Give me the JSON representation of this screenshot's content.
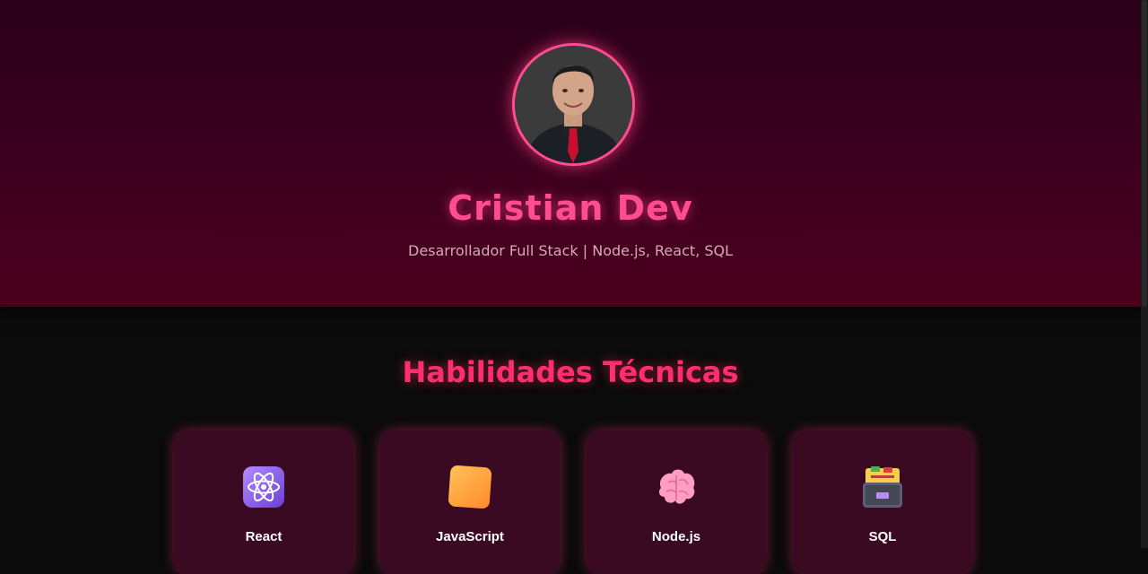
{
  "profile": {
    "name": "Cristian Dev",
    "subtitle": "Desarrollador Full Stack | Node.js, React, SQL",
    "avatar_alt": "profile-photo"
  },
  "skills": {
    "title": "Habilidades Técnicas",
    "items": [
      {
        "label": "React",
        "icon": "atom-icon"
      },
      {
        "label": "JavaScript",
        "icon": "orange-square-icon"
      },
      {
        "label": "Node.js",
        "icon": "brain-icon"
      },
      {
        "label": "SQL",
        "icon": "file-cabinet-icon"
      }
    ]
  },
  "colors": {
    "accent": "#ff4d8f",
    "title": "#ff2e6e",
    "card_bg": "#3a0a22",
    "hero_top": "#2a0019",
    "hero_bottom": "#4a001d",
    "page_bg": "#0b0b0b"
  }
}
